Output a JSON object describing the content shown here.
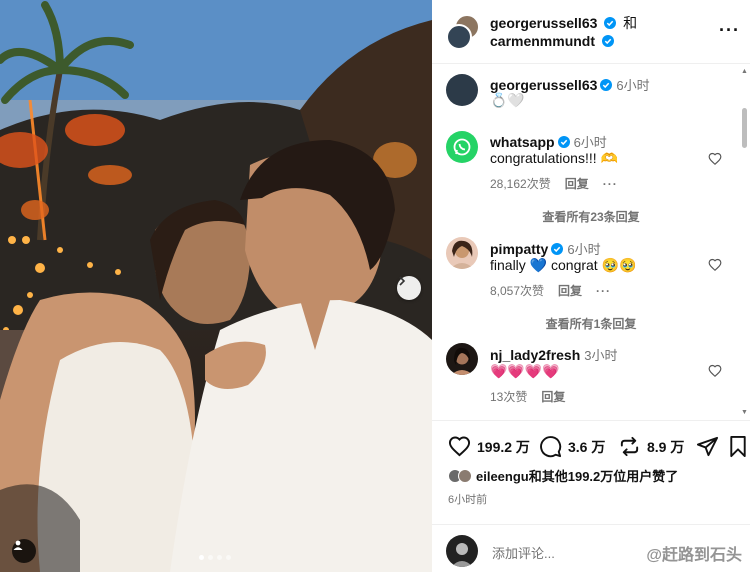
{
  "post": {
    "authors": [
      "georgerussell63",
      "carmenmmundt"
    ],
    "conjunction": "和",
    "carousel": {
      "count": 4,
      "active_index": 0
    }
  },
  "caption": {
    "user": "georgerussell63",
    "time": "6小时",
    "emoji": "💍🤍"
  },
  "comments": [
    {
      "user": "whatsapp",
      "verified": true,
      "time": "6小时",
      "text": "congratulations!!! 🫶",
      "likes": "28,162次赞",
      "reply": "回复",
      "view_replies": "查看所有23条回复"
    },
    {
      "user": "pimpatty",
      "verified": true,
      "time": "6小时",
      "text": "finally 💙 congrat 🥹🥹",
      "likes": "8,057次赞",
      "reply": "回复",
      "view_replies": "查看所有1条回复"
    },
    {
      "user": "nj_lady2fresh",
      "verified": false,
      "time": "3小时",
      "text": "💗💗💗💗",
      "likes": "13次赞",
      "reply": "回复"
    }
  ],
  "actions": {
    "likes": "199.2 万",
    "comments": "3.6 万",
    "reposts": "8.9 万"
  },
  "liked_by": "eileengu和其他199.2万位用户赞了",
  "post_time": "6小时前",
  "add_comment": {
    "placeholder": "添加评论..."
  },
  "watermark": "@赶路到石头",
  "colors": {
    "verified": "#0095f6",
    "muted": "#737373",
    "heart": "#ff3b6b"
  }
}
